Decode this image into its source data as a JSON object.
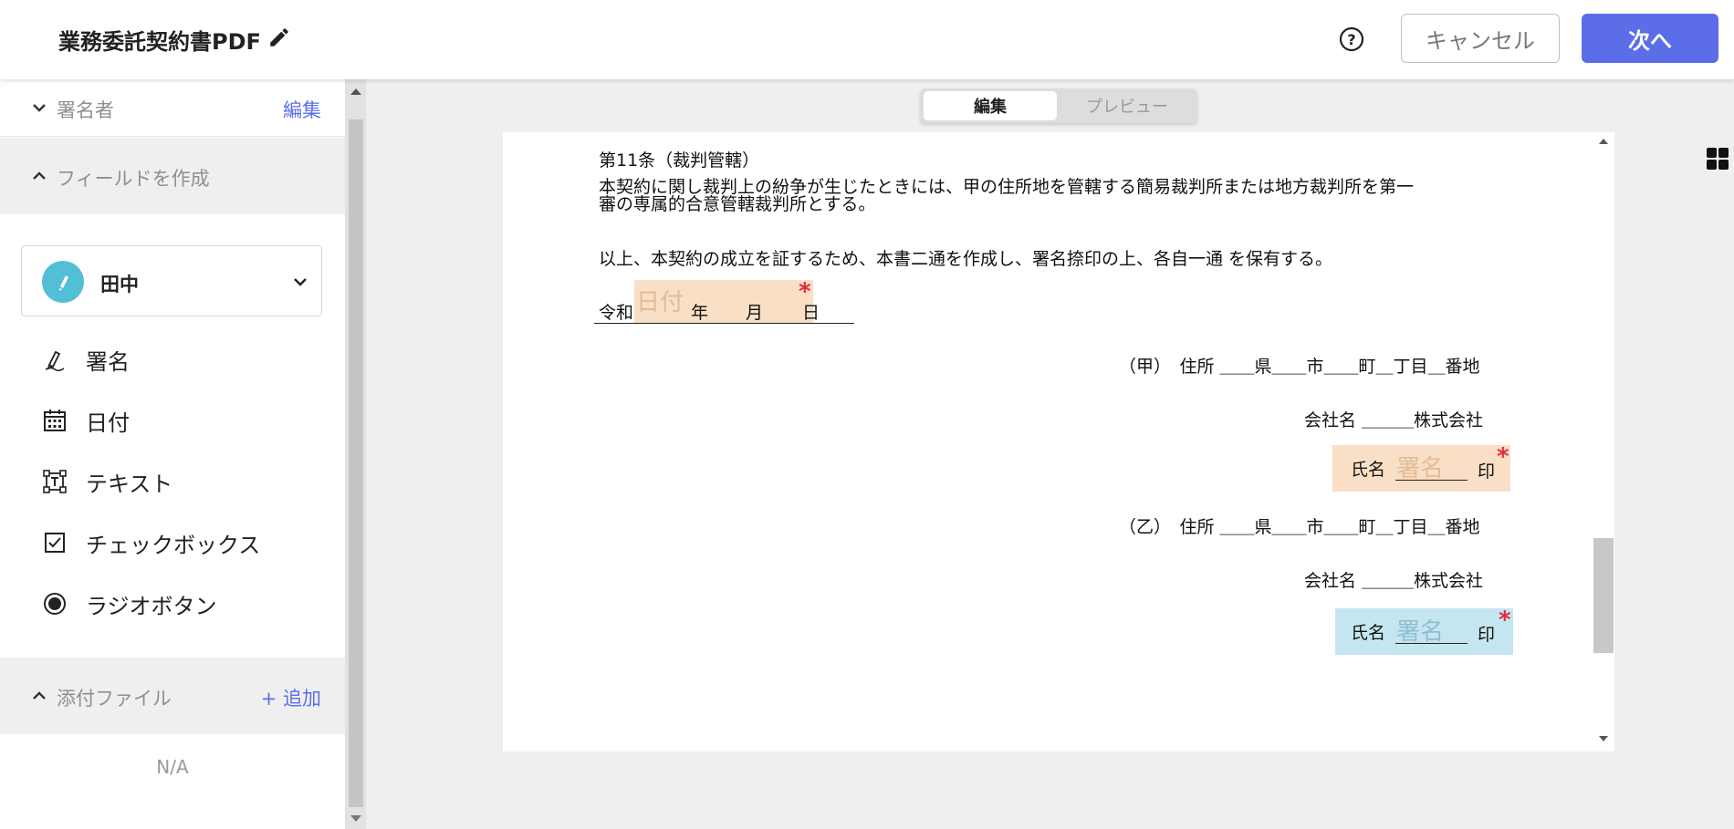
{
  "header": {
    "title": "業務委託契約書PDF",
    "edit_title_icon": "pencil-icon",
    "help_icon": "question-circle-icon",
    "cancel_label": "キャンセル",
    "next_label": "次へ"
  },
  "sidebar": {
    "signers": {
      "label": "署名者",
      "action": "編集"
    },
    "create_fields": {
      "label": "フィールドを作成"
    },
    "signer_select": {
      "name": "田中",
      "avatar_icon": "pen-icon"
    },
    "field_types": [
      {
        "label": "署名",
        "icon": "signature-pen-icon"
      },
      {
        "label": "日付",
        "icon": "calendar-icon"
      },
      {
        "label": "テキスト",
        "icon": "text-box-icon"
      },
      {
        "label": "チェックボックス",
        "icon": "checkbox-icon"
      },
      {
        "label": "ラジオボタン",
        "icon": "radio-button-icon"
      }
    ],
    "attachments": {
      "label": "添付ファイル",
      "action": "+ 追加",
      "empty": "N/A"
    }
  },
  "view_toggle": {
    "edit": "編集",
    "preview": "プレビュー"
  },
  "document": {
    "article_title": "第11条（裁判管轄）",
    "article_line1": "本契約に関し裁判上の紛争が生じたときには、甲の住所地を管轄する簡易裁判所または地方裁判所を第一",
    "article_line2": "審の専属的合意管轄裁判所とする。",
    "closing": "以上、本契約の成立を証するため、本書二通を作成し、署名捺印の上、各自一通 を保有する。",
    "era": "令和",
    "year": "年",
    "month": "月",
    "day": "日",
    "date_placeholder": "日付",
    "party_a": {
      "address": "（甲）　住所 ＿＿県＿＿市＿＿町＿丁目＿番地",
      "company": "会社名 ＿＿＿株式会社",
      "name_label": "氏名",
      "sig_placeholder": "署名",
      "seal": "印"
    },
    "party_b": {
      "address": "（乙）　住所 ＿＿県＿＿市＿＿町＿丁目＿番地",
      "company": "会社名 ＿＿＿株式会社",
      "name_label": "氏名",
      "sig_placeholder": "署名",
      "seal": "印"
    },
    "required_mark": "*"
  },
  "colors": {
    "accent": "#5b6ee8",
    "signer_a_field": "#f8dfc6",
    "signer_b_field": "#c4e6f0",
    "required": "#e52b3a",
    "avatar": "#53bfd6"
  }
}
